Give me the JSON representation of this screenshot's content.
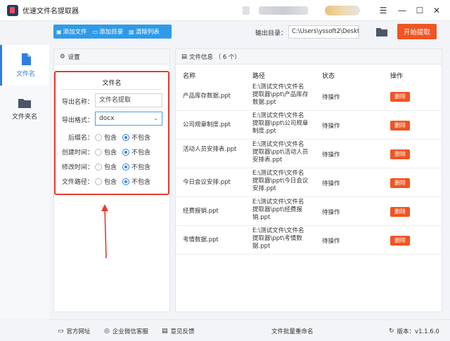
{
  "app": {
    "title": "优速文件名提取器"
  },
  "sidebar": {
    "items": [
      {
        "label": "文件名"
      },
      {
        "label": "文件夹名"
      }
    ]
  },
  "toolbar": {
    "add_file": "添加文件",
    "add_dir": "添加目录",
    "clear_list": "清除列表"
  },
  "output": {
    "label": "输出目录：",
    "path": "C:\\Users\\yssoft2\\Deskt"
  },
  "start_button": "开始提取",
  "settings": {
    "header": "设置",
    "section_title": "文件名",
    "export_name_label": "导出名称：",
    "export_name_value": "文件名提取",
    "export_format_label": "导出格式：",
    "export_format_value": "docx",
    "options": [
      {
        "label": "后缀名：",
        "include": "包含",
        "exclude": "不包含",
        "selected": "exclude"
      },
      {
        "label": "创建时间：",
        "include": "包含",
        "exclude": "不包含",
        "selected": "exclude"
      },
      {
        "label": "修改时间：",
        "include": "包含",
        "exclude": "不包含",
        "selected": "exclude"
      },
      {
        "label": "文件路径：",
        "include": "包含",
        "exclude": "不包含",
        "selected": "exclude"
      }
    ]
  },
  "files": {
    "header": "文件信息 （ 6 个）",
    "columns": {
      "name": "名称",
      "path": "路径",
      "status": "状态",
      "action": "操作"
    },
    "rows": [
      {
        "name": "产品库存数据.ppt",
        "path": "E:\\测试文件\\文件名提取器\\ppt\\产品库存数据.ppt",
        "status": "待操作",
        "action": "删除"
      },
      {
        "name": "公司规章制度.ppt",
        "path": "E:\\测试文件\\文件名提取器\\ppt\\公司规章制度.ppt",
        "status": "待操作",
        "action": "删除"
      },
      {
        "name": "活动人员安排表.ppt",
        "path": "E:\\测试文件\\文件名提取器\\ppt\\活动人员安排表.ppt",
        "status": "待操作",
        "action": "删除"
      },
      {
        "name": "今日会议安排.ppt",
        "path": "E:\\测试文件\\文件名提取器\\ppt\\今日会议安排.ppt",
        "status": "待操作",
        "action": "删除"
      },
      {
        "name": "经费报销.ppt",
        "path": "E:\\测试文件\\文件名提取器\\ppt\\经费报销.ppt",
        "status": "待操作",
        "action": "删除"
      },
      {
        "name": "考情数据.ppt",
        "path": "E:\\测试文件\\文件名提取器\\ppt\\考情数据.ppt",
        "status": "待操作",
        "action": "删除"
      }
    ]
  },
  "footer": {
    "website": "官方网址",
    "wechat": "企业微信客服",
    "feedback": "意见反馈",
    "center": "文件批量重命名",
    "version": "版本：v1.1.6.0"
  },
  "colors": {
    "accent": "#2f9be8",
    "action": "#f05423",
    "highlight": "#e63b32"
  }
}
